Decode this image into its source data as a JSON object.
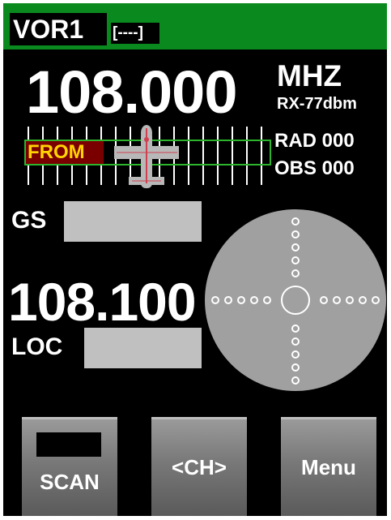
{
  "header": {
    "mode": "VOR1",
    "ident": "[----]",
    "color": "#0a8a1e"
  },
  "vor": {
    "frequency": "108.000",
    "unit": "MHZ",
    "rx": "RX-77dbm",
    "radial": "RAD 000",
    "obs": "OBS 000",
    "to_from": "FROM",
    "flag_color": "#7a0000",
    "flag_text_color": "#ffd400",
    "cdi_border_color": "#2db52d"
  },
  "ils": {
    "gs_label": "GS",
    "frequency": "108.100",
    "loc_label": "LOC"
  },
  "buttons": {
    "scan": "SCAN",
    "ch": "<CH>",
    "menu": "Menu"
  },
  "icons": {
    "cdi_aircraft": "airplane-icon"
  }
}
